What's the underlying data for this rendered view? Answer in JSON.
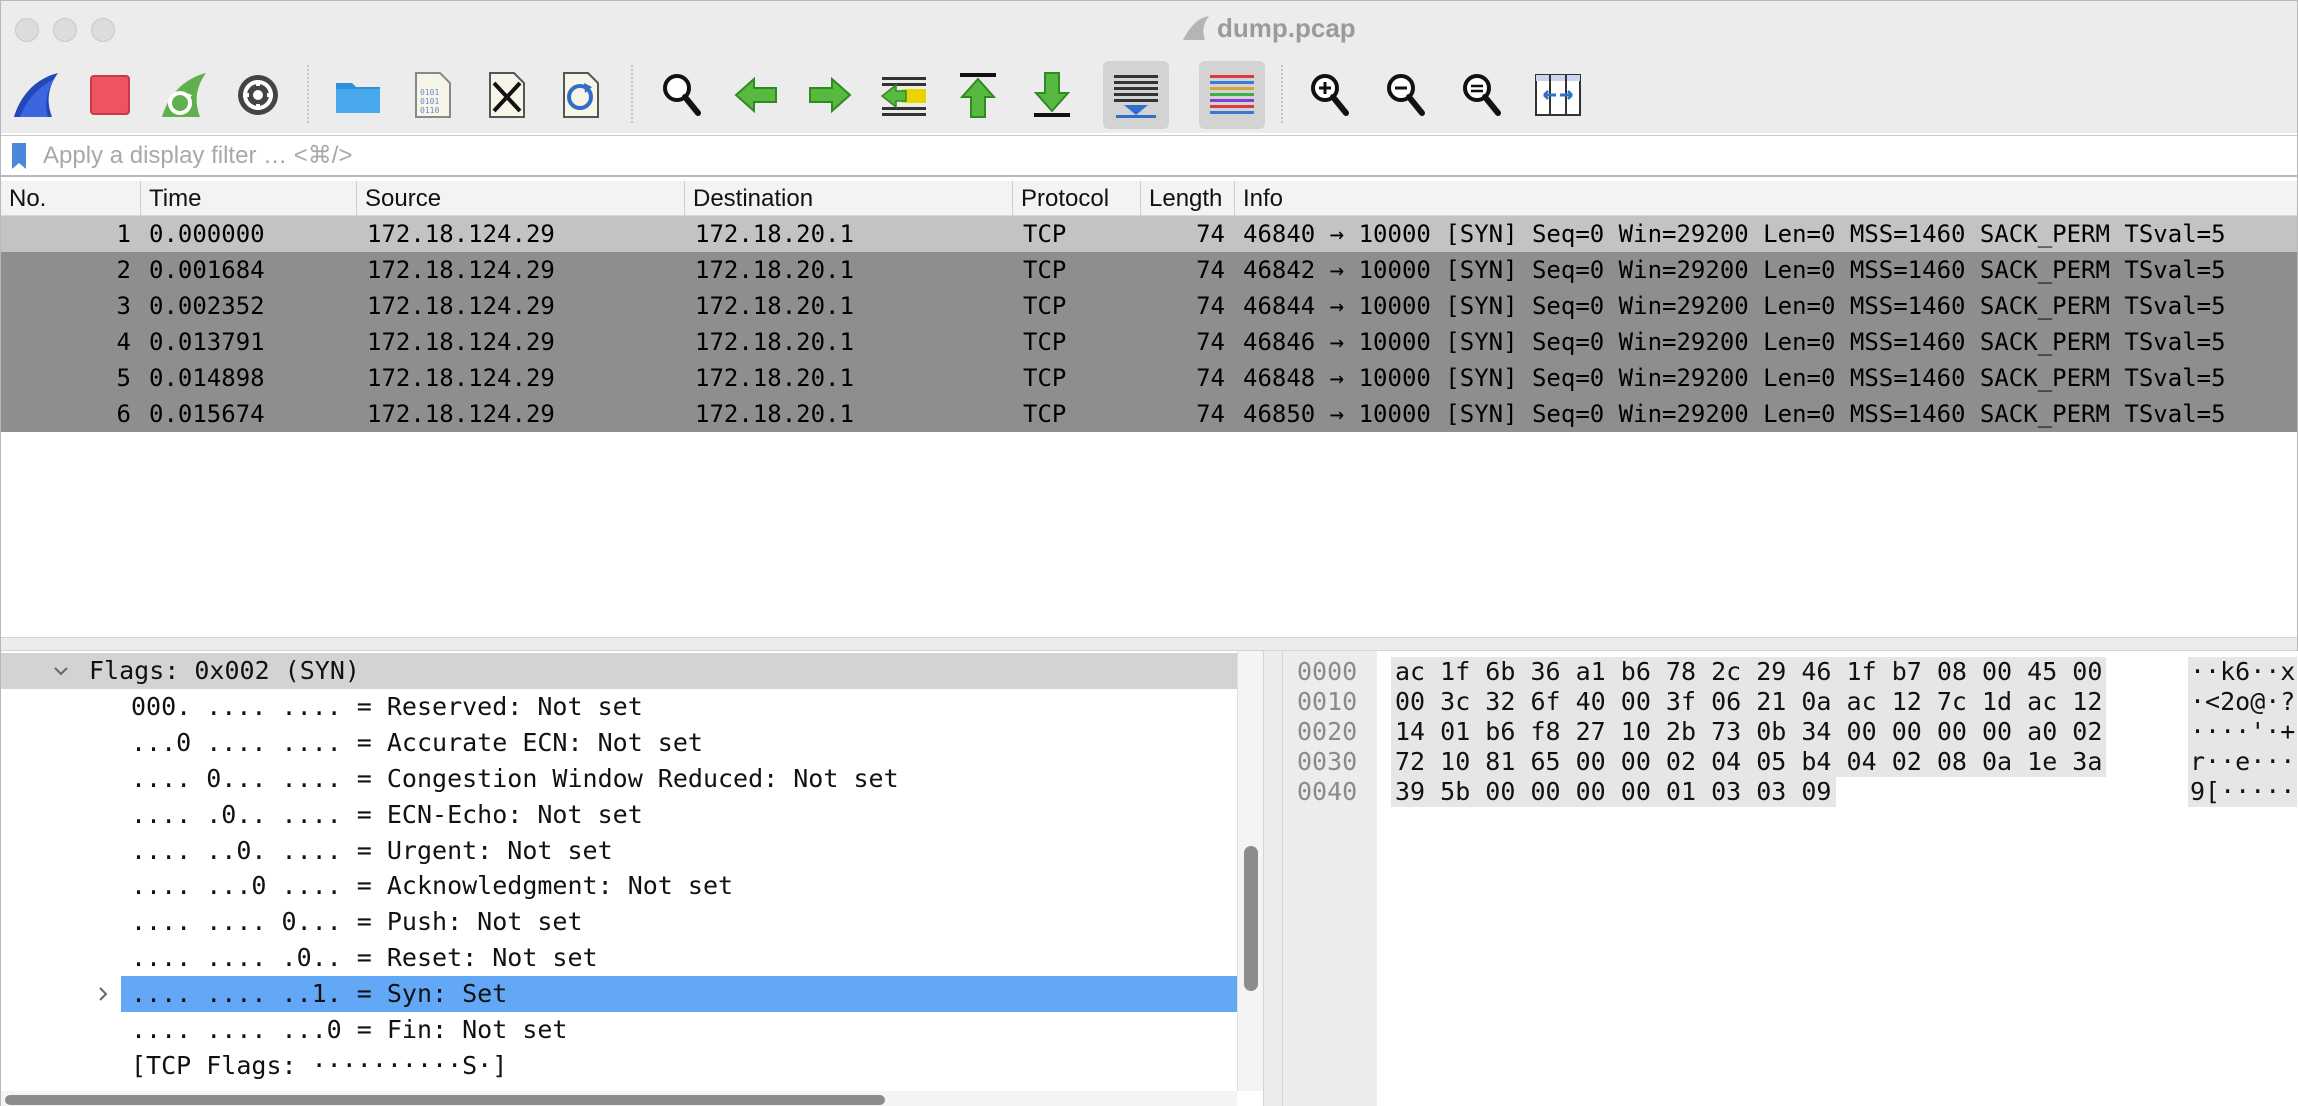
{
  "window": {
    "title": "dump.pcap"
  },
  "toolbar": {
    "buttons": [
      {
        "name": "start-capture",
        "icon": "shark-fin-icon"
      },
      {
        "name": "stop-capture",
        "icon": "stop-icon"
      },
      {
        "name": "restart-capture",
        "icon": "restart-fin-icon"
      },
      {
        "name": "capture-options",
        "icon": "gear-icon"
      },
      {
        "name": "open-file",
        "icon": "folder-icon"
      },
      {
        "name": "save-file",
        "icon": "binary-file-icon"
      },
      {
        "name": "close-file",
        "icon": "close-file-icon"
      },
      {
        "name": "reload-file",
        "icon": "reload-file-icon"
      },
      {
        "name": "find-packet",
        "icon": "magnifier-icon"
      },
      {
        "name": "go-back",
        "icon": "arrow-left-icon"
      },
      {
        "name": "go-forward",
        "icon": "arrow-right-icon"
      },
      {
        "name": "go-to-packet",
        "icon": "go-to-packet-icon"
      },
      {
        "name": "first-packet",
        "icon": "arrow-up-bar-icon"
      },
      {
        "name": "last-packet",
        "icon": "arrow-down-bar-icon"
      },
      {
        "name": "auto-scroll",
        "icon": "auto-scroll-icon"
      },
      {
        "name": "colorize",
        "icon": "colorize-lines-icon"
      },
      {
        "name": "zoom-in",
        "icon": "zoom-in-icon"
      },
      {
        "name": "zoom-out",
        "icon": "zoom-out-icon"
      },
      {
        "name": "normal-size",
        "icon": "zoom-reset-icon"
      },
      {
        "name": "resize-columns",
        "icon": "resize-columns-icon"
      }
    ],
    "active": [
      "auto-scroll",
      "colorize"
    ]
  },
  "filter": {
    "placeholder": "Apply a display filter … <⌘/>",
    "value": ""
  },
  "packet_list": {
    "columns": [
      "No.",
      "Time",
      "Source",
      "Destination",
      "Protocol",
      "Length",
      "Info"
    ],
    "rows": [
      {
        "no": "1",
        "time": "0.000000",
        "source": "172.18.124.29",
        "destination": "172.18.20.1",
        "protocol": "TCP",
        "length": "74",
        "info": "46840 → 10000 [SYN] Seq=0 Win=29200 Len=0 MSS=1460 SACK_PERM TSval=5"
      },
      {
        "no": "2",
        "time": "0.001684",
        "source": "172.18.124.29",
        "destination": "172.18.20.1",
        "protocol": "TCP",
        "length": "74",
        "info": "46842 → 10000 [SYN] Seq=0 Win=29200 Len=0 MSS=1460 SACK_PERM TSval=5"
      },
      {
        "no": "3",
        "time": "0.002352",
        "source": "172.18.124.29",
        "destination": "172.18.20.1",
        "protocol": "TCP",
        "length": "74",
        "info": "46844 → 10000 [SYN] Seq=0 Win=29200 Len=0 MSS=1460 SACK_PERM TSval=5"
      },
      {
        "no": "4",
        "time": "0.013791",
        "source": "172.18.124.29",
        "destination": "172.18.20.1",
        "protocol": "TCP",
        "length": "74",
        "info": "46846 → 10000 [SYN] Seq=0 Win=29200 Len=0 MSS=1460 SACK_PERM TSval=5"
      },
      {
        "no": "5",
        "time": "0.014898",
        "source": "172.18.124.29",
        "destination": "172.18.20.1",
        "protocol": "TCP",
        "length": "74",
        "info": "46848 → 10000 [SYN] Seq=0 Win=29200 Len=0 MSS=1460 SACK_PERM TSval=5"
      },
      {
        "no": "6",
        "time": "0.015674",
        "source": "172.18.124.29",
        "destination": "172.18.20.1",
        "protocol": "TCP",
        "length": "74",
        "info": "46850 → 10000 [SYN] Seq=0 Win=29200 Len=0 MSS=1460 SACK_PERM TSval=5"
      }
    ],
    "selected_index": 0
  },
  "details": {
    "lines": [
      {
        "text": "Flags: 0x002 (SYN)",
        "expander": "expanded"
      },
      {
        "text": "000. .... .... = Reserved: Not set"
      },
      {
        "text": "...0 .... .... = Accurate ECN: Not set"
      },
      {
        "text": ".... 0... .... = Congestion Window Reduced: Not set"
      },
      {
        "text": ".... .0.. .... = ECN-Echo: Not set"
      },
      {
        "text": ".... ..0. .... = Urgent: Not set"
      },
      {
        "text": ".... ...0 .... = Acknowledgment: Not set"
      },
      {
        "text": ".... .... 0... = Push: Not set"
      },
      {
        "text": ".... .... .0.. = Reset: Not set"
      },
      {
        "text": ".... .... ..1. = Syn: Set",
        "expander": "collapsed",
        "highlighted": true
      },
      {
        "text": ".... .... ...0 = Fin: Not set"
      },
      {
        "text": "[TCP Flags: ··········S·]"
      }
    ]
  },
  "bytes": {
    "rows": [
      {
        "offset": "0000",
        "hex": "ac 1f 6b 36 a1 b6 78 2c  29 46 1f b7 08 00 45 00",
        "ascii": "··k6··x"
      },
      {
        "offset": "0010",
        "hex": "00 3c 32 6f 40 00 3f 06  21 0a ac 12 7c 1d ac 12",
        "ascii": "·<2o@·?"
      },
      {
        "offset": "0020",
        "hex": "14 01 b6 f8 27 10 2b 73  0b 34 00 00 00 00 a0 02",
        "ascii": "····'·+"
      },
      {
        "offset": "0030",
        "hex": "72 10 81 65 00 00 02 04  05 b4 04 02 08 0a 1e 3a",
        "ascii": "r··e···"
      },
      {
        "offset": "0040",
        "hex": "39 5b 00 00 00 00 01 03  03 09",
        "ascii": "9[·····"
      }
    ]
  }
}
